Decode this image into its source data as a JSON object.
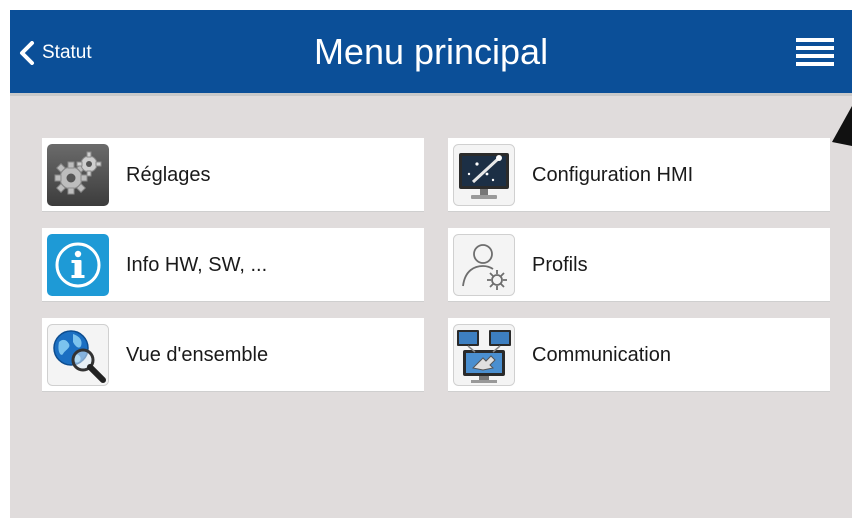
{
  "header": {
    "back_label": "Statut",
    "title": "Menu principal",
    "menu_icon": "hamburger-menu-icon",
    "back_icon": "chevron-left-icon"
  },
  "colors": {
    "header_bg": "#0b4f98",
    "screen_bg": "#e0dcdc",
    "tile_bg": "#ffffff",
    "info_blue": "#1e9ad6"
  },
  "tiles": [
    {
      "label": "Réglages",
      "icon": "gears-icon"
    },
    {
      "label": "Configuration HMI",
      "icon": "monitor-wand-icon"
    },
    {
      "label": "Info HW, SW, ...",
      "icon": "info-icon"
    },
    {
      "label": "Profils",
      "icon": "user-gear-icon"
    },
    {
      "label": "Vue d'ensemble",
      "icon": "globe-magnifier-icon"
    },
    {
      "label": "Communication",
      "icon": "network-computers-icon"
    }
  ]
}
